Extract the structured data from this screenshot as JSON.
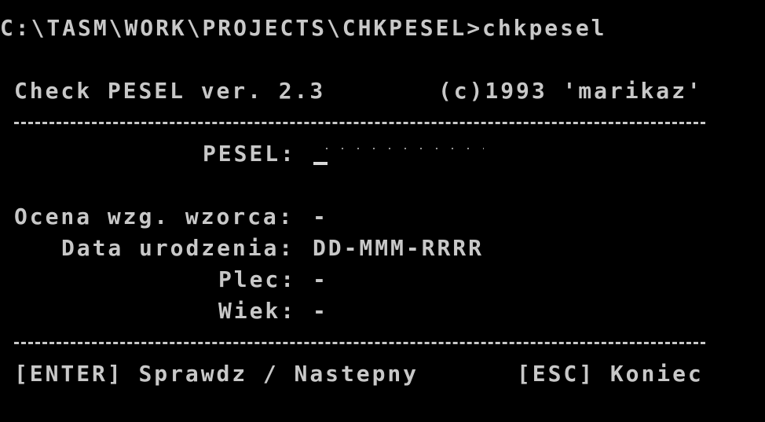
{
  "terminal": {
    "prompt": "C:\\TASM\\WORK\\PROJECTS\\CHKPESEL>",
    "command": "chkpesel"
  },
  "app": {
    "title": "Check PESEL ver. 2.3",
    "copyright": "(c)1993 'marikaz'"
  },
  "form": {
    "pesel_label": "PESEL:",
    "pesel_value": ""
  },
  "results": {
    "ocena_label": "Ocena wzg. wzorca:",
    "ocena_value": "-",
    "data_label": "Data urodzenia:",
    "data_value": "DD-MMM-RRRR",
    "plec_label": "Plec:",
    "plec_value": "-",
    "wiek_label": "Wiek:",
    "wiek_value": "-"
  },
  "footer": {
    "enter_hint": "[ENTER] Sprawdz / Nastepny",
    "esc_hint": "[ESC] Koniec"
  },
  "colors": {
    "background": "#000000",
    "text": "#c8c8c8"
  }
}
